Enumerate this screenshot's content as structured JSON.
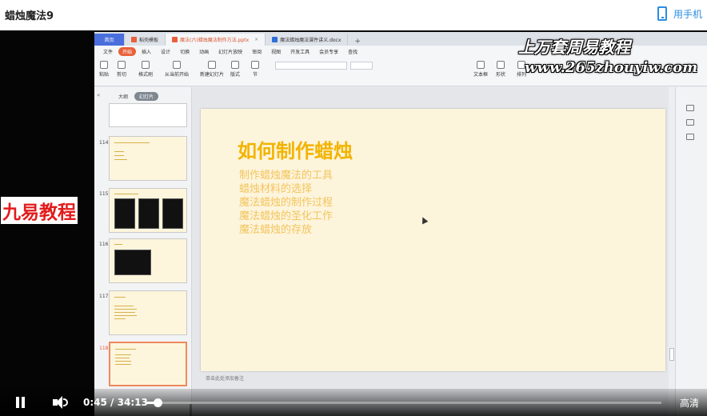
{
  "header": {
    "title": "蜡烛魔法9",
    "phone_label": "用手机"
  },
  "app": {
    "tabs": [
      {
        "label": "首页"
      },
      {
        "label": "稻壳模板"
      },
      {
        "label": "魔法(六)蜡烛魔法制作方法.pptx"
      },
      {
        "label": "魔法蜡烛魔法课件讲义.docx"
      }
    ],
    "tab_plus": "+",
    "menu": [
      "文件",
      "开始",
      "插入",
      "设计",
      "切换",
      "动画",
      "幻灯片放映",
      "审阅",
      "视图",
      "开发工具",
      "会员专享",
      "查找"
    ],
    "share_label": "分享",
    "ribbon": {
      "buttons": [
        "粘贴",
        "剪切",
        "复制",
        "格式刷",
        "从当前开始",
        "新建幻灯片",
        "版式",
        "节",
        "文本框",
        "形状",
        "排列"
      ],
      "reset_label": "重置"
    },
    "panel": {
      "collapse": "«",
      "tabs": [
        "大纲",
        "幻灯片"
      ],
      "thumb_numbers": [
        "114",
        "115",
        "116",
        "117",
        "118"
      ]
    },
    "slide": {
      "title": "如何制作蜡烛",
      "items": [
        "制作蜡烛魔法的工具",
        "蜡烛材料的选择",
        "魔法蜡烛的制作过程",
        "魔法蜡烛的圣化工作",
        "魔法蜡烛的存放"
      ]
    },
    "notes_placeholder": "单击此处添加备注"
  },
  "watermarks": {
    "line1": "上万套周易教程",
    "line2": "www.265zhouyiw.com",
    "left": "九易教程"
  },
  "player": {
    "current_time": "0:45",
    "separator": "/",
    "duration": "34:13",
    "progress": 0.022,
    "quality": "高清"
  }
}
